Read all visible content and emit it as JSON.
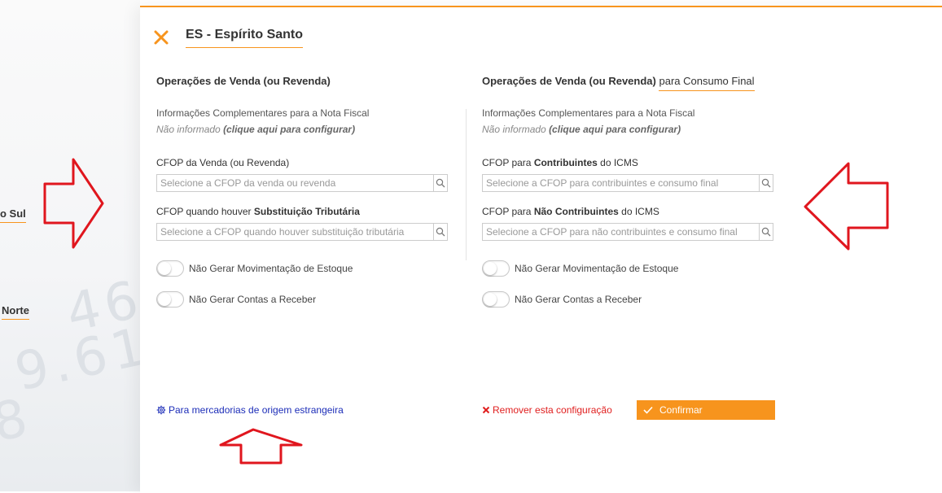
{
  "background": {
    "labels": [
      "o Sul",
      "Norte"
    ],
    "digits": [
      "46",
      "9.61",
      "8"
    ]
  },
  "modal": {
    "title": "ES - Espírito Santo",
    "close_icon": "close-icon",
    "accent_color": "#f7941d"
  },
  "left": {
    "title": "Operações de Venda (ou Revenda)",
    "info_label": "Informações Complementares para a Nota Fiscal",
    "info_value_prefix": "Não informado",
    "info_value_link": "(clique aqui para configurar)",
    "cfop_sale_label": "CFOP da Venda (ou Revenda)",
    "cfop_sale_placeholder": "Selecione a CFOP da venda ou revenda",
    "cfop_st_label_prefix": "CFOP quando houver",
    "cfop_st_label_bold": "Substituição Tributária",
    "cfop_st_placeholder": "Selecione a CFOP quando houver substituição tributária",
    "toggle_stock": "Não Gerar Movimentação de Estoque",
    "toggle_receivables": "Não Gerar Contas a Receber"
  },
  "right": {
    "title_bold": "Operações de Venda (ou Revenda)",
    "title_normal": "para Consumo Final",
    "info_label": "Informações Complementares para a Nota Fiscal",
    "info_value_prefix": "Não informado",
    "info_value_link": "(clique aqui para configurar)",
    "cfop_contrib_label_prefix": "CFOP para",
    "cfop_contrib_label_bold": "Contribuintes",
    "cfop_contrib_label_suffix": "do ICMS",
    "cfop_contrib_placeholder": "Selecione a CFOP para contribuintes e consumo final",
    "cfop_noncontrib_label_prefix": "CFOP para",
    "cfop_noncontrib_label_bold": "Não Contribuintes",
    "cfop_noncontrib_label_suffix": "do ICMS",
    "cfop_noncontrib_placeholder": "Selecione a CFOP para não contribuintes e consumo final",
    "toggle_stock": "Não Gerar Movimentação de Estoque",
    "toggle_receivables": "Não Gerar Contas a Receber"
  },
  "footer": {
    "foreign_link": "Para mercadorias de origem estrangeira",
    "foreign_icon": "gear-icon",
    "remove_link": "Remover esta configuração",
    "remove_icon": "x-icon",
    "confirm_label": "Confirmar",
    "confirm_icon": "check-icon",
    "link_color": "#1c2db8",
    "remove_color": "#e01e1e"
  },
  "annotations": {
    "arrow_color": "#e0161e"
  }
}
